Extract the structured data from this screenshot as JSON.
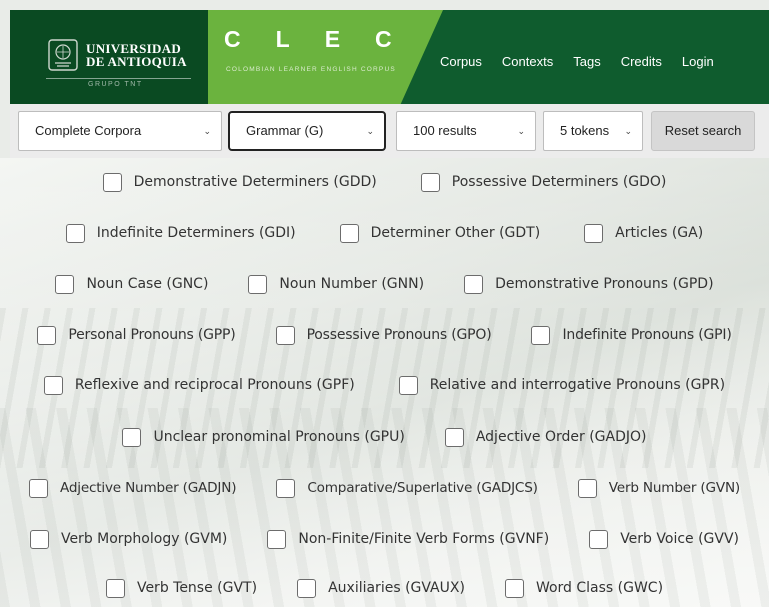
{
  "header": {
    "university_line1": "UNIVERSIDAD",
    "university_line2": "DE ANTIOQUIA",
    "university_sub": "GRUPO TNT",
    "clec_letters": [
      "C",
      "L",
      "E",
      "C"
    ],
    "clec_sub": "COLOMBIAN LEARNER ENGLISH CORPUS",
    "nav": [
      "Corpus",
      "Contexts",
      "Tags",
      "Credits",
      "Login"
    ]
  },
  "search": {
    "corpora": "Complete Corpora",
    "category": "Grammar (G)",
    "results": "100 results",
    "tokens": "5 tokens",
    "reset": "Reset search"
  },
  "options": [
    [
      "Demonstrative Determiners (GDD)",
      "Possessive Determiners (GDO)"
    ],
    [
      "Indefinite Determiners (GDI)",
      "Determiner Other (GDT)",
      "Articles (GA)"
    ],
    [
      "Noun Case (GNC)",
      "Noun Number (GNN)",
      "Demonstrative Pronouns (GPD)"
    ],
    [
      "Personal Pronouns (GPP)",
      "Possessive Pronouns (GPO)",
      "Indefinite Pronouns (GPI)"
    ],
    [
      "Reflexive and reciprocal Pronouns (GPF)",
      "Relative and interrogative Pronouns (GPR)"
    ],
    [
      "Unclear pronominal Pronouns (GPU)",
      "Adjective Order (GADJO)"
    ],
    [
      "Adjective Number (GADJN)",
      "Comparative/Superlative (GADJCS)",
      "Verb Number (GVN)"
    ],
    [
      "Verb Morphology (GVM)",
      "Non-Finite/Finite Verb Forms (GVNF)",
      "Verb Voice (GVV)"
    ],
    [
      "Verb Tense (GVT)",
      "Auxiliaries (GVAUX)",
      "Word Class (GWC)"
    ]
  ],
  "colors": {
    "header_dark": "#0a4a22",
    "header_green": "#0f5c2e",
    "clec_green": "#6bb33e"
  }
}
